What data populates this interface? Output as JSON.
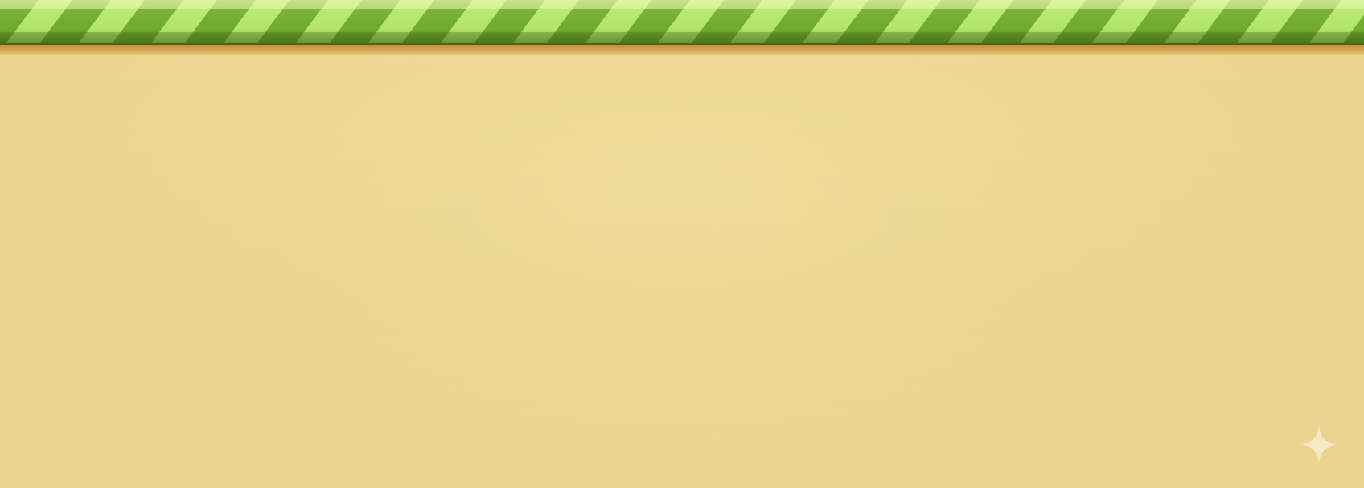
{
  "scene": {
    "background_color": "#ebd48f",
    "bar": {
      "colors": {
        "light_stripe": "#b4e66a",
        "dark_stripe": "#6fac2c",
        "highlight": "#eafa9a",
        "shade": "#4d7f1c",
        "edge": "#3f6b14"
      }
    },
    "sparkle": {
      "icon": "four-point-star-icon",
      "color": "#f6e9c6"
    }
  }
}
